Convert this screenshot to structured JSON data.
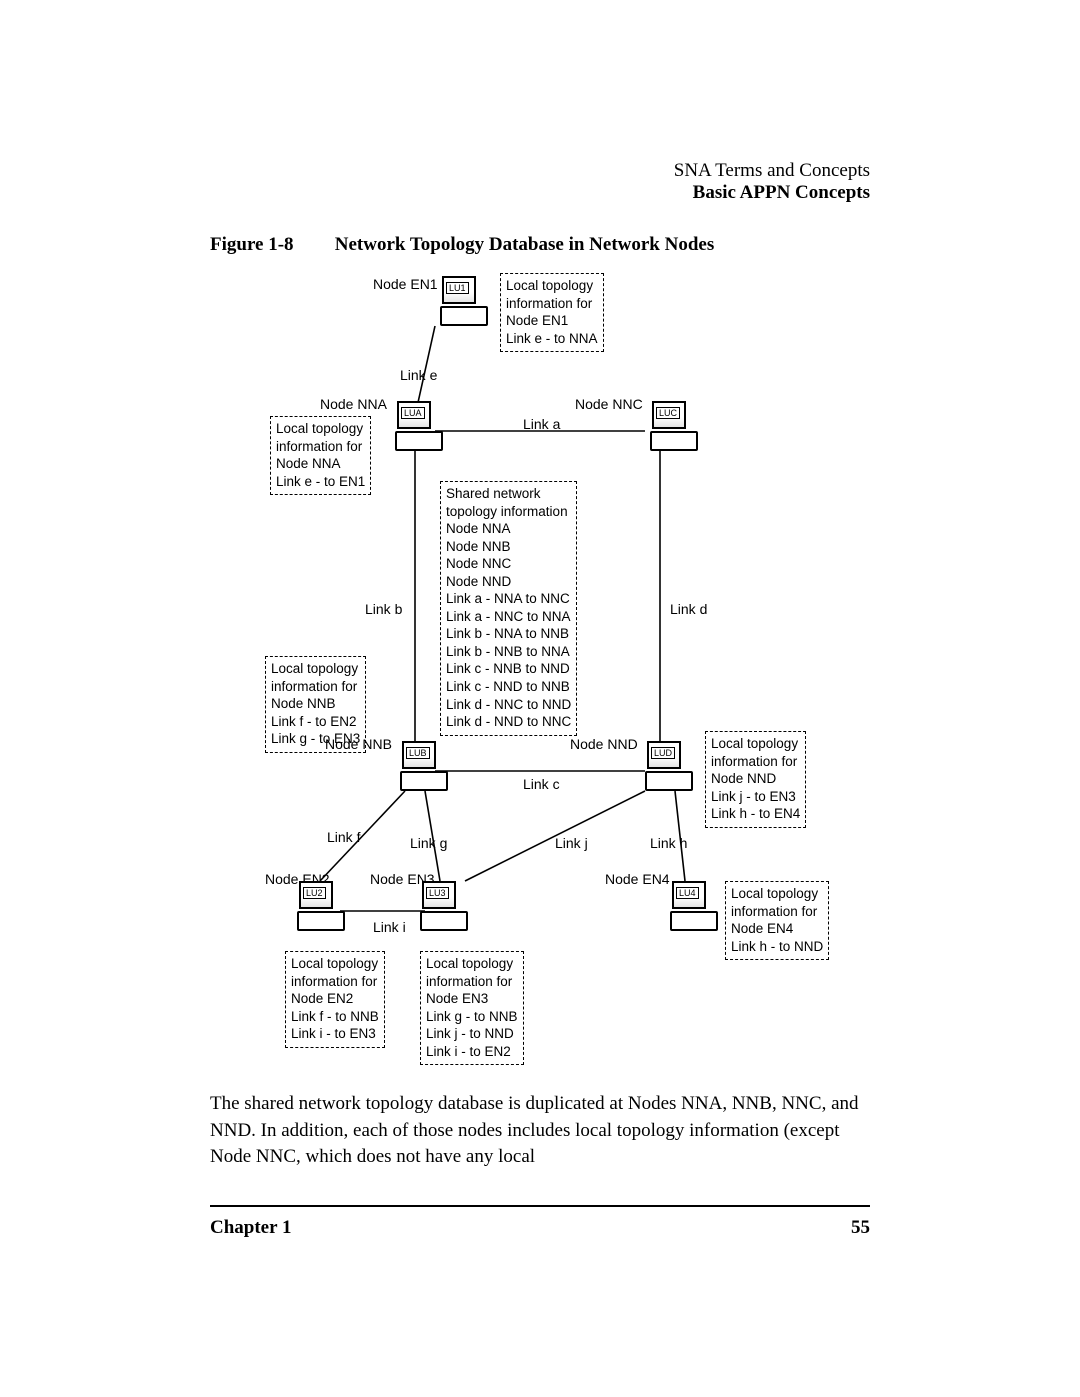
{
  "header": {
    "section": "SNA Terms and Concepts",
    "subsection": "Basic APPN Concepts"
  },
  "figure": {
    "label": "Figure 1-8",
    "title": "Network Topology Database in Network Nodes"
  },
  "diagram": {
    "nodes": {
      "en1": {
        "name": "Node EN1",
        "lu": "LU1"
      },
      "nna": {
        "name": "Node NNA",
        "lu": "LUA"
      },
      "nnc": {
        "name": "Node NNC",
        "lu": "LUC"
      },
      "nnb": {
        "name": "Node NNB",
        "lu": "LUB"
      },
      "nnd": {
        "name": "Node NND",
        "lu": "LUD"
      },
      "en2": {
        "name": "Node EN2",
        "lu": "LU2"
      },
      "en3": {
        "name": "Node EN3",
        "lu": "LU3"
      },
      "en4": {
        "name": "Node EN4",
        "lu": "LU4"
      }
    },
    "links": {
      "e": "Link e",
      "a": "Link a",
      "b": "Link b",
      "c": "Link c",
      "d": "Link d",
      "f": "Link f",
      "g": "Link g",
      "h": "Link h",
      "i": "Link i",
      "j": "Link j"
    },
    "topology_boxes": {
      "en1": "Local topology\ninformation for\nNode EN1\nLink e - to NNA",
      "nna": "Local topology\ninformation for\nNode NNA\nLink e - to EN1",
      "shared": "Shared network\ntopology information\nNode NNA\nNode NNB\nNode NNC\nNode NND\nLink a - NNA to NNC\nLink a - NNC to NNA\nLink b - NNA to NNB\nLink b - NNB to NNA\nLink c - NNB to NND\nLink c - NND to NNB\nLink d - NNC to NND\nLink d - NND to NNC",
      "nnb": "Local topology\ninformation for\nNode NNB\nLink f - to EN2\nLink g - to EN3",
      "nnd": "Local topology\ninformation for\nNode NND\nLink j - to EN3\nLink h - to EN4",
      "en2": "Local topology\ninformation for\nNode EN2\nLink f - to NNB\nLink i - to EN3",
      "en3": "Local topology\ninformation for\nNode EN3\nLink g - to NNB\nLink j - to NND\nLink i - to EN2",
      "en4": "Local topology\ninformation for\nNode EN4\nLink h - to NND"
    }
  },
  "body_paragraph": "The shared network topology database is duplicated at Nodes NNA, NNB, NNC, and NND. In addition, each of those nodes includes local topology information (except Node NNC, which does not have any local",
  "footer": {
    "chapter": "Chapter 1",
    "page": "55"
  }
}
